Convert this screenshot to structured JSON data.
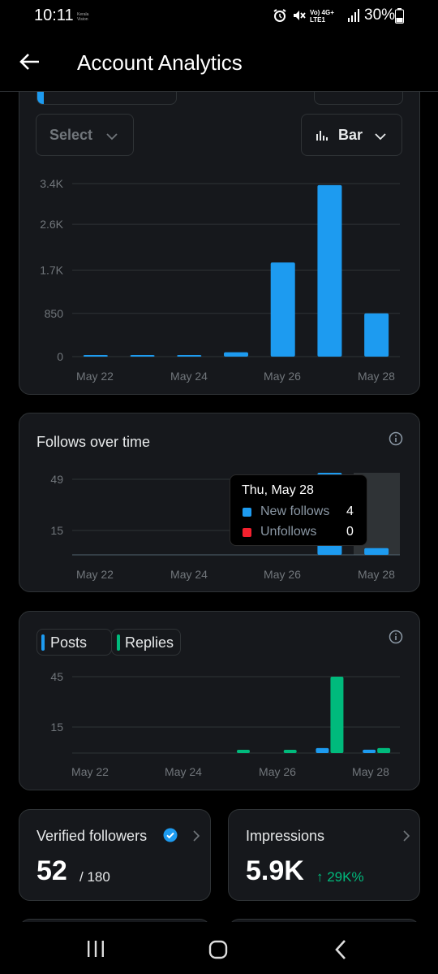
{
  "status": {
    "time": "10:11",
    "carrier": "Kerala Vision",
    "network": "Vo) 4G+ LTE1",
    "battery": "30%"
  },
  "header": {
    "title": "Account Analytics"
  },
  "chart1": {
    "select_label": "Select",
    "type_label": "Bar",
    "chart_data": {
      "type": "bar",
      "categories": [
        "May 22",
        "May 23",
        "May 24",
        "May 25",
        "May 26",
        "May 27",
        "May 28"
      ],
      "values": [
        15,
        0,
        15,
        85,
        1850,
        3370,
        850
      ],
      "yticks": [
        "3.4K",
        "2.6K",
        "1.7K",
        "850",
        "0"
      ],
      "xticks": [
        "May 22",
        "May 24",
        "May 26",
        "May 28"
      ],
      "color": "#1d9bf0"
    }
  },
  "chart2": {
    "title": "Follows over time",
    "tooltip": {
      "date": "Thu, May 28",
      "rows": [
        {
          "label": "New follows",
          "value": "4",
          "color": "#1d9bf0"
        },
        {
          "label": "Unfollows",
          "value": "0",
          "color": "#f4212e"
        }
      ]
    },
    "chart_data": {
      "type": "bar",
      "categories": [
        "May 22",
        "May 23",
        "May 24",
        "May 25",
        "May 26",
        "May 27",
        "May 28"
      ],
      "series": [
        {
          "name": "New follows",
          "values": [
            0,
            0,
            0,
            0,
            0,
            49,
            4
          ]
        },
        {
          "name": "Unfollows",
          "values": [
            0,
            0,
            0,
            0,
            0,
            0,
            0
          ]
        }
      ],
      "yticks": [
        "49",
        "15"
      ],
      "xticks": [
        "May 22",
        "May 24",
        "May 26",
        "May 28"
      ]
    }
  },
  "chart3": {
    "legend": [
      {
        "label": "Posts",
        "color": "#1d9bf0"
      },
      {
        "label": "Replies",
        "color": "#00ba7c"
      }
    ],
    "chart_data": {
      "type": "bar",
      "categories": [
        "May 22",
        "May 23",
        "May 24",
        "May 25",
        "May 26",
        "May 27",
        "May 28"
      ],
      "series": [
        {
          "name": "Posts",
          "values": [
            0,
            0,
            0,
            0,
            0,
            3,
            2
          ]
        },
        {
          "name": "Replies",
          "values": [
            0,
            0,
            0,
            1,
            1,
            46,
            3
          ]
        }
      ],
      "yticks": [
        "45",
        "15"
      ],
      "xticks": [
        "May 22",
        "May 24",
        "May 26",
        "May 28"
      ]
    }
  },
  "stats": {
    "verified": {
      "label": "Verified followers",
      "value": "52",
      "total": "/ 180"
    },
    "impressions": {
      "label": "Impressions",
      "value": "5.9K",
      "change": "↑ 29K%"
    }
  },
  "colors": {
    "accent": "#1d9bf0",
    "green": "#00ba7c",
    "red": "#f4212e"
  }
}
